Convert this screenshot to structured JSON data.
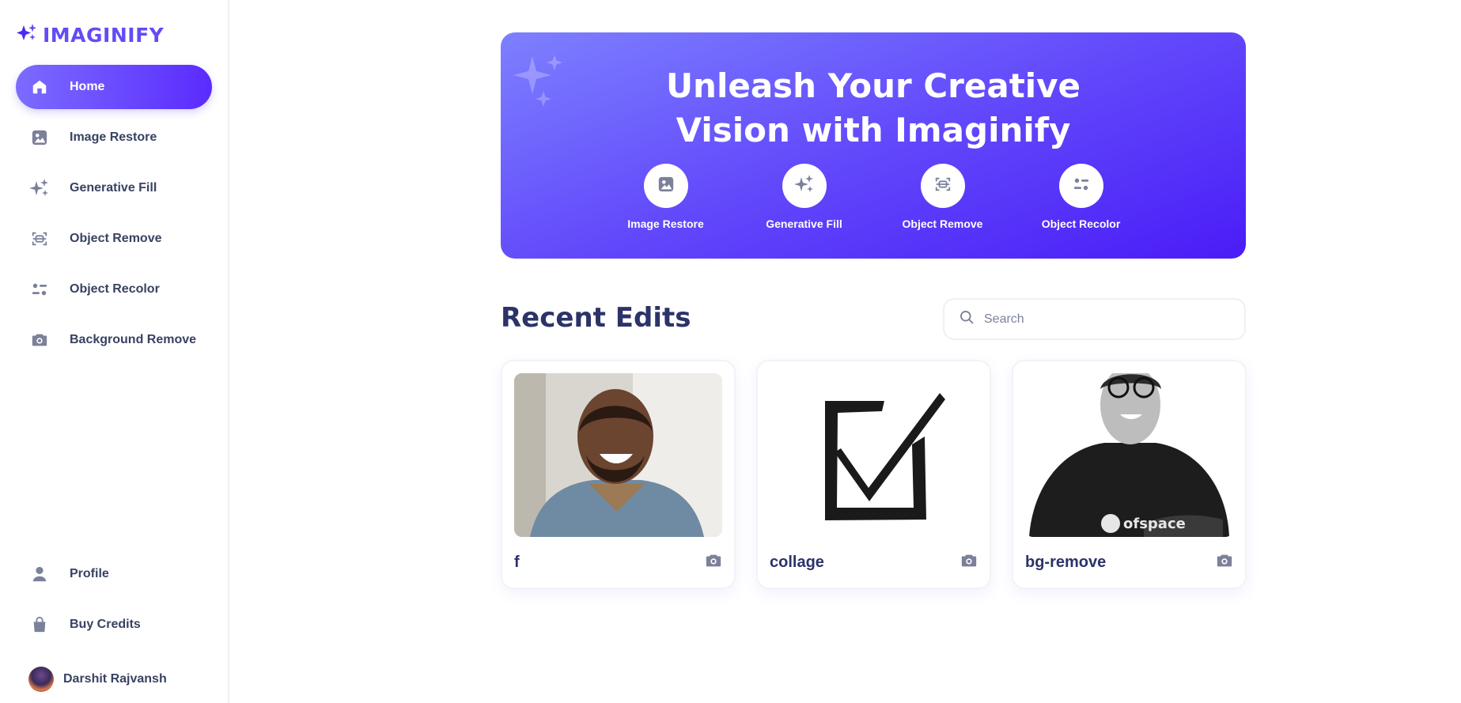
{
  "app": {
    "logo_text": "IMAGINIFY"
  },
  "sidebar": {
    "items": [
      {
        "label": "Home",
        "icon": "home-icon"
      },
      {
        "label": "Image Restore",
        "icon": "image-icon"
      },
      {
        "label": "Generative Fill",
        "icon": "stars-icon"
      },
      {
        "label": "Object Remove",
        "icon": "scan-icon"
      },
      {
        "label": "Object Recolor",
        "icon": "filter-icon"
      },
      {
        "label": "Background Remove",
        "icon": "camera-icon"
      }
    ],
    "bottom_items": [
      {
        "label": "Profile",
        "icon": "profile-icon"
      },
      {
        "label": "Buy Credits",
        "icon": "bag-icon"
      }
    ],
    "user_name": "Darshit Rajvansh"
  },
  "banner": {
    "title_line1": "Unleash Your Creative",
    "title_line2": "Vision with Imaginify",
    "tools": [
      {
        "label": "Image Restore",
        "icon": "image-icon"
      },
      {
        "label": "Generative Fill",
        "icon": "stars-icon"
      },
      {
        "label": "Object Remove",
        "icon": "scan-icon"
      },
      {
        "label": "Object Recolor",
        "icon": "filter-icon"
      }
    ]
  },
  "recent": {
    "title": "Recent Edits",
    "search_placeholder": "Search",
    "cards": [
      {
        "name": "f",
        "icon": "camera-icon"
      },
      {
        "name": "collage",
        "icon": "camera-icon"
      },
      {
        "name": "bg-remove",
        "icon": "camera-icon"
      }
    ]
  },
  "colors": {
    "accent": "#624cf5",
    "banner_start": "#7d80ff",
    "banner_end": "#4a1cf7",
    "heading": "#2b3369",
    "icon_gray": "#7c819a"
  }
}
